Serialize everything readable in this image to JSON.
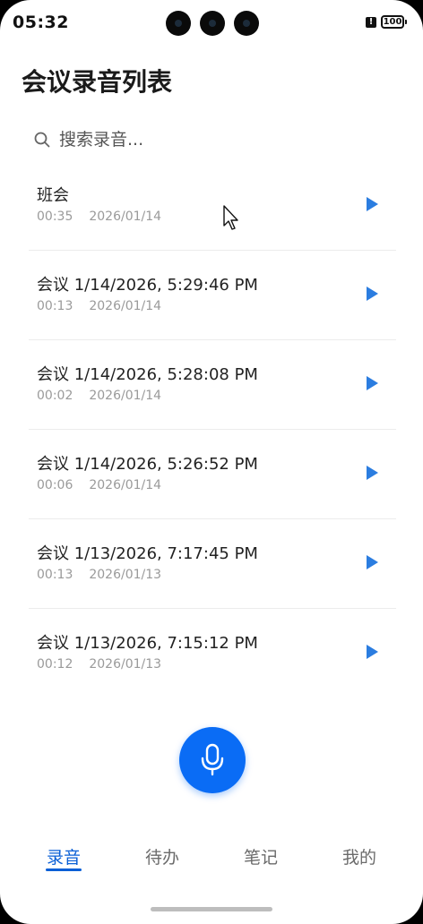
{
  "status": {
    "time": "05:32",
    "alert": "!",
    "battery": "100"
  },
  "page": {
    "title": "会议录音列表"
  },
  "search": {
    "placeholder": "搜索录音..."
  },
  "recordings": [
    {
      "title": "班会",
      "duration": "00:35",
      "date": "2026/01/14"
    },
    {
      "title": "会议 1/14/2026, 5:29:46 PM",
      "duration": "00:13",
      "date": "2026/01/14"
    },
    {
      "title": "会议 1/14/2026, 5:28:08 PM",
      "duration": "00:02",
      "date": "2026/01/14"
    },
    {
      "title": "会议 1/14/2026, 5:26:52 PM",
      "duration": "00:06",
      "date": "2026/01/14"
    },
    {
      "title": "会议 1/13/2026, 7:17:45 PM",
      "duration": "00:13",
      "date": "2026/01/13"
    },
    {
      "title": "会议 1/13/2026, 7:15:12 PM",
      "duration": "00:12",
      "date": "2026/01/13"
    }
  ],
  "tabs": [
    {
      "label": "录音",
      "active": true
    },
    {
      "label": "待办",
      "active": false
    },
    {
      "label": "笔记",
      "active": false
    },
    {
      "label": "我的",
      "active": false
    }
  ],
  "colors": {
    "accent": "#0a6cf5",
    "play": "#2b7de0",
    "active_tab": "#0a5fd6"
  },
  "icons": {
    "search": "search-icon",
    "play": "play-icon",
    "mic": "microphone-icon",
    "cursor": "cursor-icon"
  }
}
